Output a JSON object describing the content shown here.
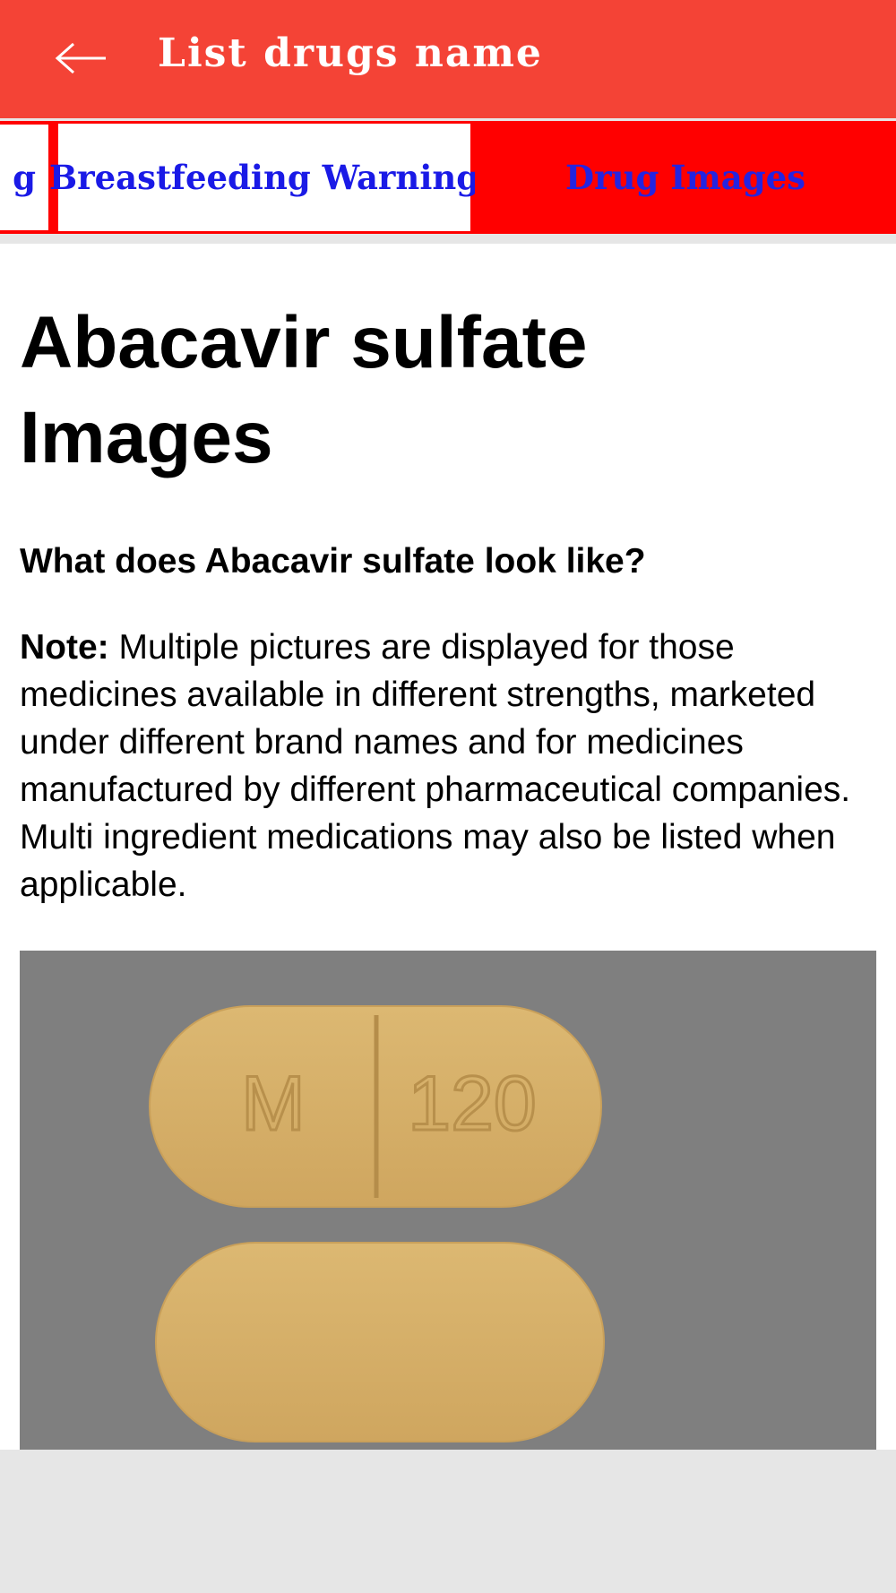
{
  "appbar": {
    "back_icon": "arrow-left-icon",
    "title": "List drugs name",
    "bg_color": "#f44336"
  },
  "tabs": {
    "previous_fragment": "g",
    "breastfeeding": "Breastfeeding Warning",
    "images": "Drug Images",
    "active": "Drug Images",
    "tab_text_color": "#1a1ae6",
    "tab_bg_color": "#ff0000"
  },
  "page": {
    "title": "Abacavir sulfate Images",
    "question": "What does Abacavir sulfate look like?",
    "note_label": "Note:",
    "note_text": " Multiple pictures are displayed for those medicines available in different strengths, marketed under different brand names and for medicines manufactured by different pharmaceutical companies. Multi ingredient medications may also be listed when applicable."
  },
  "pill_image": {
    "imprint_left": "M",
    "imprint_right": "120",
    "pill_color": "#d6b06a",
    "background_color": "#7f7f7f"
  }
}
